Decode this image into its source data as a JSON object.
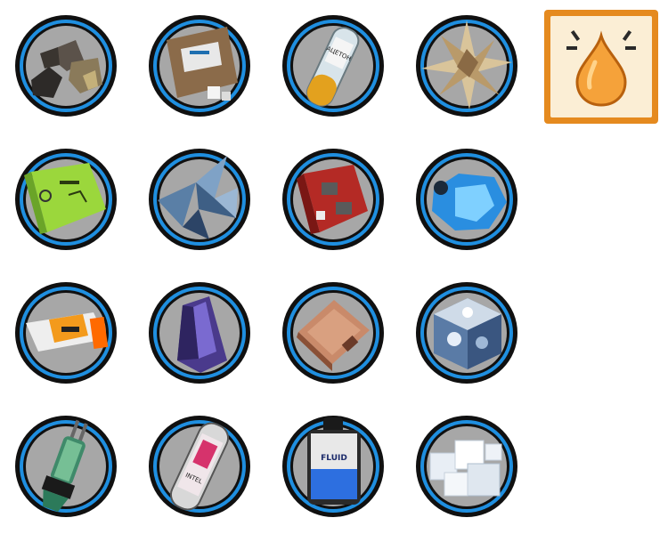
{
  "featured_icon": {
    "icon": "amber-droplet-gem-icon",
    "frame_color": "#e58a1f",
    "inner_color": "#fbeed5",
    "drop_color": "#f5a23a"
  },
  "ring_colors": {
    "outer": "#101010",
    "accent": "#1f8fe0",
    "stone": "#a7a7a7"
  },
  "items": [
    {
      "icon": "dark-ore-chunks-icon"
    },
    {
      "icon": "cardboard-box-sugar-cubes-icon"
    },
    {
      "icon": "acetone-bottle-icon",
      "label": "АЦЕТОН"
    },
    {
      "icon": "gold-star-crystal-icon"
    },
    {
      "icon": "green-battery-pack-icon"
    },
    {
      "icon": "blue-metal-shards-icon"
    },
    {
      "icon": "red-machine-block-icon"
    },
    {
      "icon": "blue-crystal-cluster-icon"
    },
    {
      "icon": "energy-bar-wrapper-icon"
    },
    {
      "icon": "purple-crystal-icon"
    },
    {
      "icon": "copper-plate-icon"
    },
    {
      "icon": "silver-cube-crystal-icon"
    },
    {
      "icon": "green-fuse-tube-icon"
    },
    {
      "icon": "glass-capsule-icon",
      "label": "INTEL"
    },
    {
      "icon": "blue-fluid-canister-icon",
      "label": "FLUID"
    },
    {
      "icon": "white-salt-crystals-icon"
    }
  ]
}
